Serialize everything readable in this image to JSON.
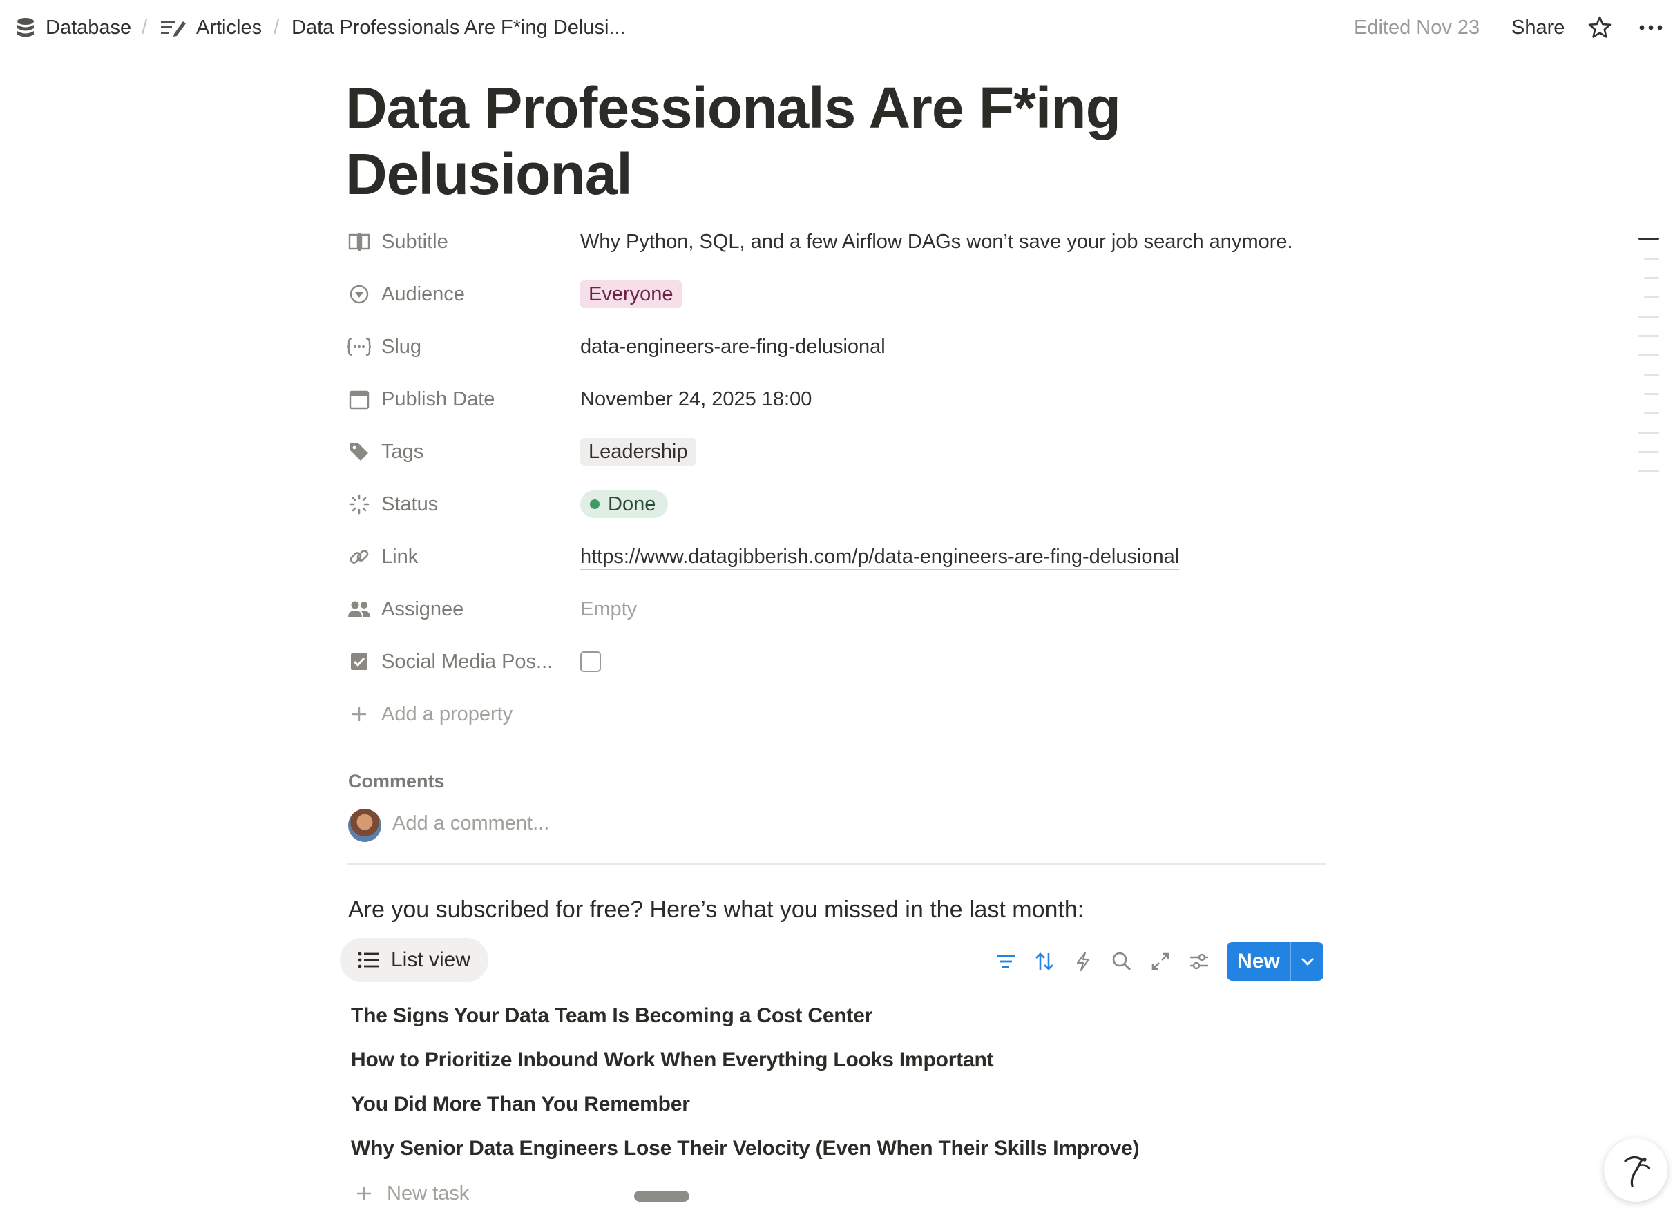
{
  "breadcrumb": {
    "database": "Database",
    "articles": "Articles",
    "current": "Data Professionals Are F*ing Delusi...",
    "separator": "/"
  },
  "header": {
    "edited": "Edited Nov 23",
    "share": "Share",
    "icons": [
      "database-icon",
      "edit-list-icon",
      "star-icon",
      "more-icon"
    ]
  },
  "page": {
    "title": "Data Professionals Are F*ing Delusional"
  },
  "properties": {
    "subtitle": {
      "label": "Subtitle",
      "value": "Why Python, SQL, and a few Airflow DAGs won’t save your job search anymore.",
      "icon": "text-cursor-icon"
    },
    "audience": {
      "label": "Audience",
      "value": "Everyone",
      "icon": "select-icon"
    },
    "slug": {
      "label": "Slug",
      "value": "data-engineers-are-fing-delusional",
      "icon": "formula-braces-icon"
    },
    "publish_date": {
      "label": "Publish Date",
      "value": "November 24, 2025 18:00",
      "icon": "calendar-icon"
    },
    "tags": {
      "label": "Tags",
      "value": "Leadership",
      "icon": "tag-icon"
    },
    "status": {
      "label": "Status",
      "value": "Done",
      "icon": "status-spinner-icon",
      "color": "#3e9a66"
    },
    "link": {
      "label": "Link",
      "value": "https://www.datagibberish.com/p/data-engineers-are-fing-delusional",
      "icon": "link-icon"
    },
    "assignee": {
      "label": "Assignee",
      "value": "Empty",
      "icon": "people-icon"
    },
    "social_media": {
      "label": "Social Media Pos...",
      "checked": false,
      "icon": "checkbox-icon"
    },
    "add_property": "Add a property"
  },
  "comments": {
    "heading": "Comments",
    "placeholder": "Add a comment..."
  },
  "section": {
    "intro": "Are you subscribed for free? Here’s what you missed in the last month:"
  },
  "list": {
    "view_label": "List view",
    "new_button": "New",
    "toolbar_icons": [
      "filter-icon",
      "sort-icon",
      "automation-bolt-icon",
      "search-icon",
      "expand-icon",
      "settings-sliders-icon"
    ],
    "items": [
      "The Signs Your Data Team Is Becoming a Cost Center",
      "How to Prioritize Inbound Work When Everything Looks Important",
      "You Did More Than You Remember",
      "Why Senior Data Engineers Lose Their Velocity (Even When Their Skills Improve)"
    ],
    "new_task": "New task"
  },
  "colors": {
    "accent": "#2383e2",
    "everyone_pill": "#f6dfe8",
    "status_done": "#e0eee6"
  }
}
